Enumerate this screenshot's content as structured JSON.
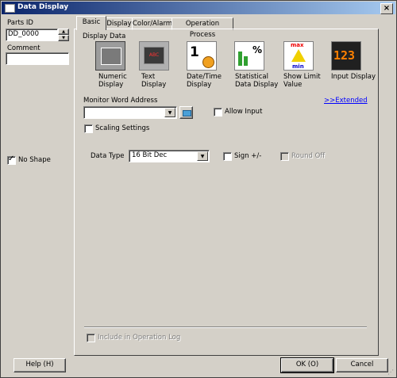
{
  "window": {
    "title": "Data Display",
    "close_glyph": "×"
  },
  "left_panel": {
    "parts_id_label": "Parts ID",
    "parts_id_value": "DD_0000",
    "comment_label": "Comment",
    "comment_value": "",
    "no_shape_label": "No Shape",
    "no_shape_checked": true
  },
  "tabs": [
    {
      "label": "Basic",
      "active": true
    },
    {
      "label": "Display",
      "active": false
    },
    {
      "label": "Color/Alarm",
      "active": false
    },
    {
      "label": "Operation Process",
      "active": false
    }
  ],
  "display_data": {
    "group_label": "Display Data",
    "items": [
      {
        "caption": "Numeric\nDisplay",
        "icon": "numeric-display-icon",
        "selected": true
      },
      {
        "caption": "Text\nDisplay",
        "icon": "text-display-icon",
        "icon_text": "ABC"
      },
      {
        "caption": "Date/Time\nDisplay",
        "icon": "date-time-display-icon",
        "icon_text": "1"
      },
      {
        "caption": "Statistical\nData Display",
        "icon": "statistical-data-display-icon",
        "icon_text": "%"
      },
      {
        "caption": "Show Limit\nValue",
        "icon": "show-limit-value-icon",
        "icon_text_top": "max",
        "icon_text_bottom": "min"
      },
      {
        "caption": "Input Display",
        "icon": "input-display-icon",
        "icon_text": "123"
      }
    ]
  },
  "monitor": {
    "label": "Monitor Word Address",
    "extended_link": ">>Extended",
    "address_value": "",
    "allow_input_label": "Allow Input",
    "scaling_label": "Scaling Settings"
  },
  "data_type": {
    "label": "Data Type",
    "value": "16 Bit Dec",
    "sign_label": "Sign +/-",
    "round_off_label": "Round Off"
  },
  "operation_log_label": "Include in Operation Log",
  "buttons": {
    "help": "Help (H)",
    "ok": "OK (O)",
    "cancel": "Cancel"
  },
  "colors": {
    "title_start": "#0a246a",
    "title_end": "#a6caf0",
    "face": "#d4d0c8",
    "link": "#0000ff"
  }
}
